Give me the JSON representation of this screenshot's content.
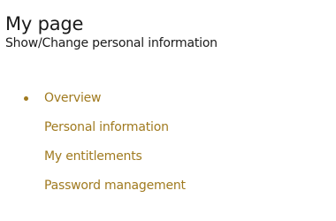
{
  "header": {
    "title": "My page",
    "subtitle": "Show/Change personal information"
  },
  "nav": {
    "accent_color": "#a07a1f",
    "items": [
      {
        "label": "Overview",
        "active": true
      },
      {
        "label": "Personal information",
        "active": false
      },
      {
        "label": "My entitlements",
        "active": false
      },
      {
        "label": "Password management",
        "active": false
      }
    ]
  }
}
